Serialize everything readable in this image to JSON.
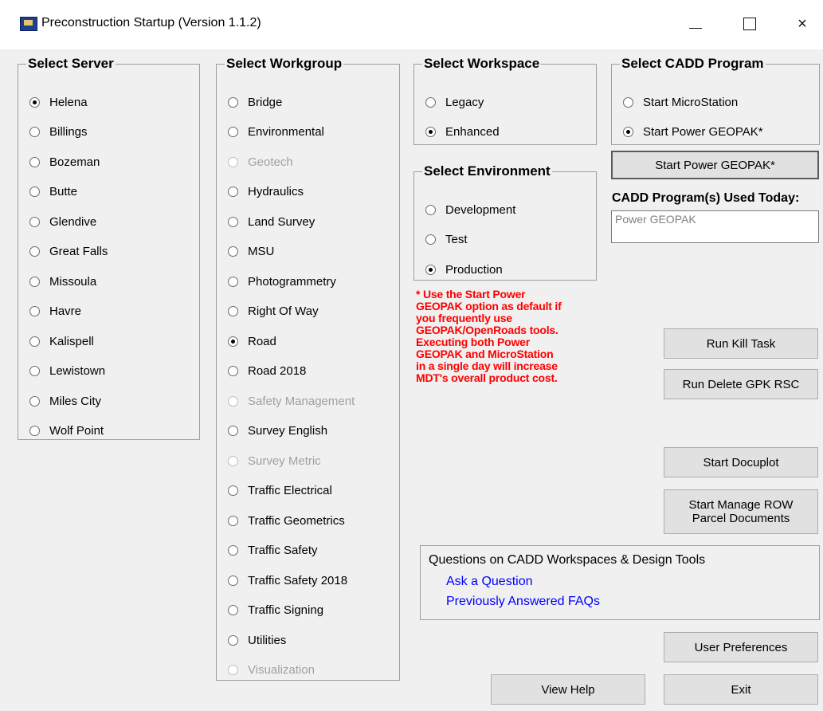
{
  "window": {
    "title": "Preconstruction Startup (Version 1.1.2)",
    "controls": {
      "minimize": "minimize-icon",
      "maximize": "maximize-icon",
      "close": "×"
    }
  },
  "server": {
    "legend": "Select Server",
    "selected": "Helena",
    "options": [
      "Helena",
      "Billings",
      "Bozeman",
      "Butte",
      "Glendive",
      "Great Falls",
      "Missoula",
      "Havre",
      "Kalispell",
      "Lewistown",
      "Miles City",
      "Wolf Point"
    ]
  },
  "workgroup": {
    "legend": "Select Workgroup",
    "selected": "Road",
    "options": [
      {
        "label": "Bridge",
        "enabled": true
      },
      {
        "label": "Environmental",
        "enabled": true
      },
      {
        "label": "Geotech",
        "enabled": false
      },
      {
        "label": "Hydraulics",
        "enabled": true
      },
      {
        "label": "Land Survey",
        "enabled": true
      },
      {
        "label": "MSU",
        "enabled": true
      },
      {
        "label": "Photogrammetry",
        "enabled": true
      },
      {
        "label": "Right Of Way",
        "enabled": true
      },
      {
        "label": "Road",
        "enabled": true
      },
      {
        "label": "Road 2018",
        "enabled": true
      },
      {
        "label": "Safety Management",
        "enabled": false
      },
      {
        "label": "Survey English",
        "enabled": true
      },
      {
        "label": "Survey Metric",
        "enabled": false
      },
      {
        "label": "Traffic Electrical",
        "enabled": true
      },
      {
        "label": "Traffic Geometrics",
        "enabled": true
      },
      {
        "label": "Traffic Safety",
        "enabled": true
      },
      {
        "label": "Traffic Safety 2018",
        "enabled": true
      },
      {
        "label": "Traffic Signing",
        "enabled": true
      },
      {
        "label": "Utilities",
        "enabled": true
      },
      {
        "label": "Visualization",
        "enabled": false
      }
    ]
  },
  "workspace": {
    "legend": "Select Workspace",
    "selected": "Enhanced",
    "options": [
      "Legacy",
      "Enhanced"
    ]
  },
  "environment": {
    "legend": "Select Environment",
    "selected": "Production",
    "options": [
      "Development",
      "Test",
      "Production"
    ]
  },
  "cadd_program": {
    "legend": "Select CADD Program",
    "selected": "Start Power GEOPAK*",
    "options": [
      "Start MicroStation",
      "Start Power GEOPAK*"
    ]
  },
  "buttons": {
    "start_program": "Start Power GEOPAK*",
    "run_kill_task": "Run Kill Task",
    "run_delete_gpk_rsc": "Run Delete GPK RSC",
    "start_docuplot": "Start Docuplot",
    "start_manage_row_line1": "Start Manage ROW",
    "start_manage_row_line2": "Parcel Documents",
    "user_preferences": "User Preferences",
    "view_help": "View Help",
    "exit": "Exit"
  },
  "used_today": {
    "label": "CADD Program(s) Used Today:",
    "value": "Power GEOPAK"
  },
  "warning": {
    "lines": [
      "* Use the Start Power",
      "GEOPAK option as default if",
      "you frequently use",
      "GEOPAK/OpenRoads tools.",
      "Executing both Power",
      "GEOPAK and MicroStation",
      "in a single day will increase",
      "MDT's overall product cost."
    ],
    "color": "#ff0000"
  },
  "questions": {
    "title": "Questions on CADD Workspaces & Design Tools",
    "links": [
      "Ask a Question",
      "Previously Answered FAQs"
    ],
    "link_color": "#0000ff"
  }
}
